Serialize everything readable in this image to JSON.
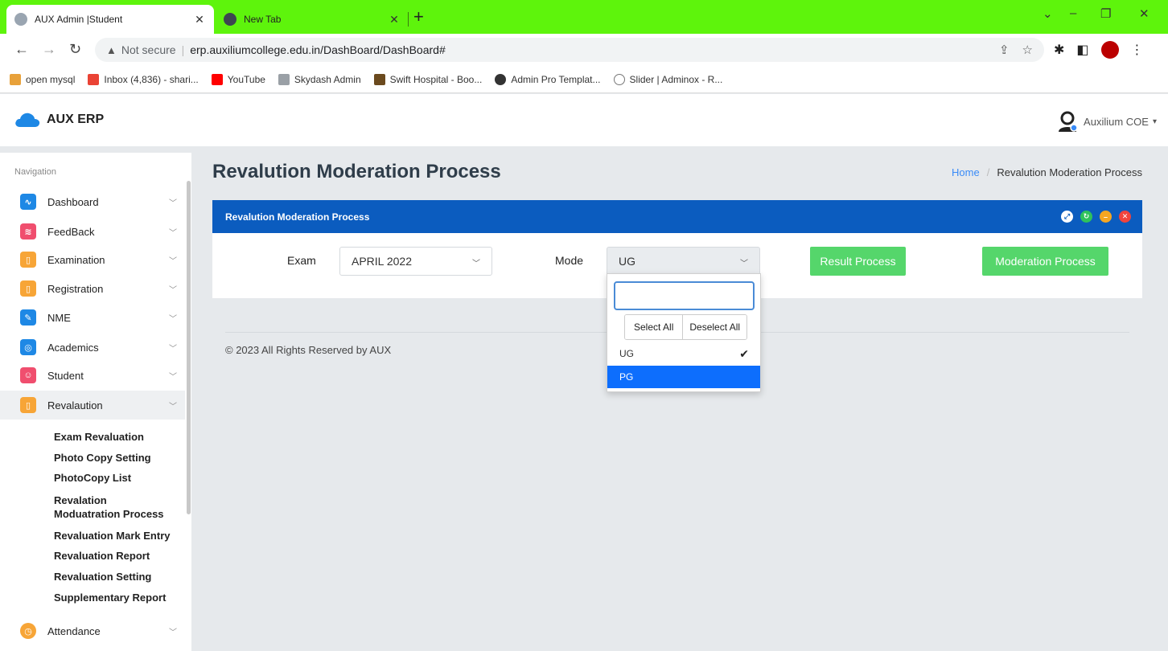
{
  "browser": {
    "tabs": [
      {
        "title": "AUX Admin |Student",
        "active": true
      },
      {
        "title": "New Tab",
        "active": false
      }
    ],
    "new_tab": "+",
    "window_controls": {
      "chevron": "⌄",
      "minimize": "–",
      "restore": "❐",
      "close": "✕"
    },
    "address": {
      "warning": "Not secure",
      "separator": "|",
      "url": "erp.auxiliumcollege.edu.in/DashBoard/DashBoard#"
    },
    "bookmarks": [
      {
        "label": "open mysql",
        "icon_color": "#e8a13a"
      },
      {
        "label": "Inbox (4,836) - shari...",
        "icon_color": "#ea4335"
      },
      {
        "label": "YouTube",
        "icon_color": "#ff0000"
      },
      {
        "label": "Skydash Admin",
        "icon_color": "#9aa0a6"
      },
      {
        "label": "Swift Hospital - Boo...",
        "icon_color": "#6b4a1e"
      },
      {
        "label": "Admin Pro Templat...",
        "icon_color": "#333333"
      },
      {
        "label": "Slider | Adminox - R...",
        "icon_color": "#777777"
      }
    ]
  },
  "header": {
    "brand": "AUX ERP",
    "user": "Auxilium COE"
  },
  "sidebar": {
    "caption": "Navigation",
    "items": [
      {
        "label": "Dashboard",
        "icon": "pulse-icon",
        "color": "#1e88e5"
      },
      {
        "label": "FeedBack",
        "icon": "rss-icon",
        "color": "#f04e6e"
      },
      {
        "label": "Examination",
        "icon": "book-icon",
        "color": "#f7a537"
      },
      {
        "label": "Registration",
        "icon": "book-icon",
        "color": "#f7a537"
      },
      {
        "label": "NME",
        "icon": "edit-icon",
        "color": "#1e88e5"
      },
      {
        "label": "Academics",
        "icon": "target-icon",
        "color": "#1e88e5"
      },
      {
        "label": "Student",
        "icon": "users-icon",
        "color": "#f04e6e"
      },
      {
        "label": "Revalaution",
        "icon": "book-icon",
        "color": "#f7a537"
      },
      {
        "label": "Attendance",
        "icon": "clock-icon",
        "color": "#f7a537"
      }
    ],
    "subitems": [
      "Exam Revaluation",
      "Photo Copy Setting",
      "PhotoCopy List",
      "Revalation Moduatration Process",
      "Revaluation Mark Entry",
      "Revaluation Report",
      "Revaluation Setting",
      "Supplementary Report"
    ]
  },
  "page": {
    "title": "Revalution Moderation Process",
    "breadcrumb": {
      "home": "Home",
      "separator": "/",
      "current": "Revalution Moderation Process"
    }
  },
  "card": {
    "title": "Revalution Moderation Process",
    "exam_label": "Exam",
    "exam_value": "APRIL 2022",
    "mode_label": "Mode",
    "mode_value": "UG",
    "result_button": "Result Process",
    "moderation_button": "Moderation Process"
  },
  "dropdown": {
    "search_value": "",
    "select_all": "Select All",
    "deselect_all": "Deselect All",
    "options": [
      {
        "label": "UG",
        "selected": true,
        "highlighted": false
      },
      {
        "label": "PG",
        "selected": false,
        "highlighted": true
      }
    ]
  },
  "footer": "© 2023 All Rights Reserved by AUX"
}
